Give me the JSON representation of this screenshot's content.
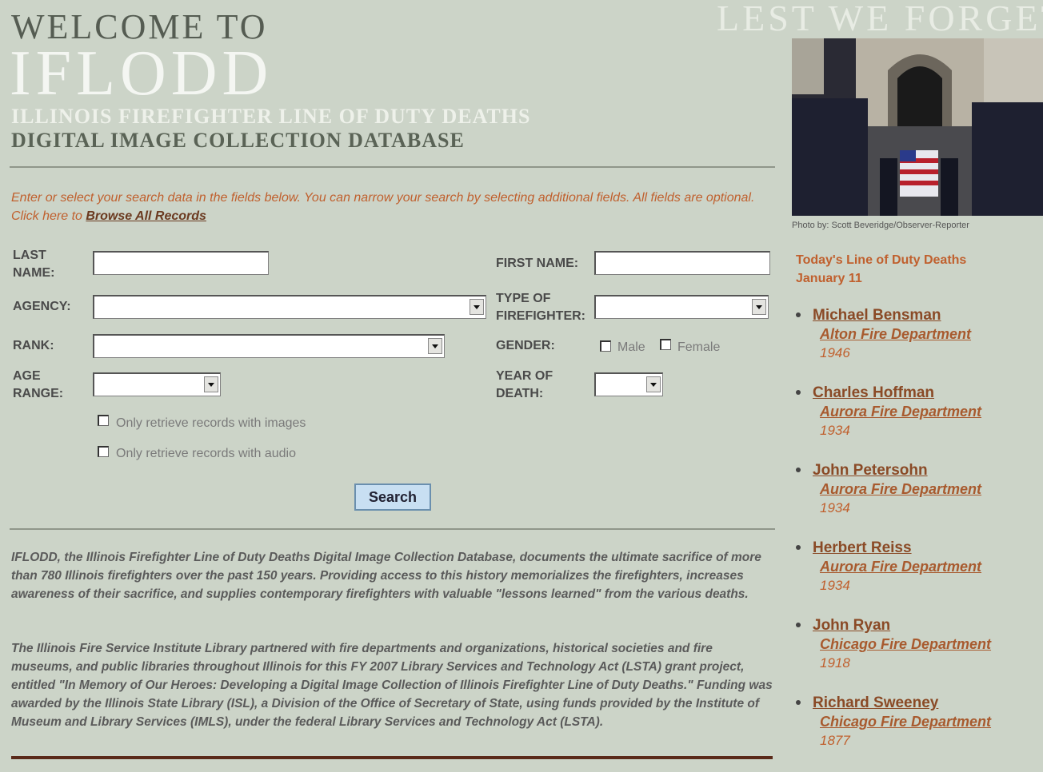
{
  "header": {
    "welcome": "WELCOME TO",
    "title": "IFLODD",
    "subtitle1": "ILLINOIS FIREFIGHTER LINE OF DUTY DEATHS",
    "subtitle2": "DIGITAL IMAGE COLLECTION DATABASE",
    "tagline": "LEST WE FORGET"
  },
  "intro": {
    "text": "Enter or select your search data in the fields below. You can narrow your search by selecting additional fields. All fields are optional. Click here to ",
    "link": "Browse All Records"
  },
  "form": {
    "last_name_label": "LAST NAME:",
    "first_name_label": "FIRST NAME:",
    "agency_label": "AGENCY:",
    "type_label": "TYPE OF FIREFIGHTER:",
    "rank_label": "RANK:",
    "gender_label": "GENDER:",
    "male_label": "Male",
    "female_label": "Female",
    "age_label": "AGE RANGE:",
    "year_label": "YEAR OF DEATH:",
    "images_label": "Only retrieve records with images",
    "audio_label": "Only retrieve records with audio",
    "search_label": "Search"
  },
  "body": {
    "para1": "IFLODD, the Illinois Firefighter Line of Duty Deaths Digital Image Collection Database, documents the ultimate sacrifice of more than 780 Illinois firefighters over the past 150 years. Providing access to this history memorializes the firefighters, increases awareness of their sacrifice, and supplies contemporary firefighters with valuable \"lessons learned\" from the various deaths.",
    "para2": "The Illinois Fire Service Institute Library partnered with fire departments and organizations, historical societies and fire museums, and public libraries throughout Illinois for this FY 2007 Library Services and Technology Act (LSTA) grant project, entitled \"In Memory of Our Heroes: Developing a Digital Image Collection of Illinois Firefighter Line of Duty Deaths.\" Funding was awarded by the Illinois State Library (ISL), a Division of the Office of Secretary of State, using funds provided by the Institute of Museum and Library Services (IMLS), under the federal Library Services and Technology Act (LSTA)."
  },
  "sidebar": {
    "photo_credit": "Photo by: Scott Beveridge/Observer-Reporter",
    "today_title": "Today's Line of Duty Deaths",
    "today_date": "January 11",
    "deaths": [
      {
        "name": "Michael Bensman",
        "dept": "Alton Fire Department",
        "year": "1946"
      },
      {
        "name": "Charles Hoffman",
        "dept": "Aurora Fire Department",
        "year": "1934"
      },
      {
        "name": "John Petersohn",
        "dept": "Aurora Fire Department",
        "year": "1934"
      },
      {
        "name": "Herbert Reiss",
        "dept": "Aurora Fire Department",
        "year": "1934"
      },
      {
        "name": "John Ryan",
        "dept": "Chicago Fire Department",
        "year": "1918"
      },
      {
        "name": "Richard Sweeney",
        "dept": "Chicago Fire Department",
        "year": "1877"
      }
    ]
  },
  "colors": {
    "background": "#ccd4c8",
    "accent": "#c0602e",
    "link": "#8a4a26"
  }
}
